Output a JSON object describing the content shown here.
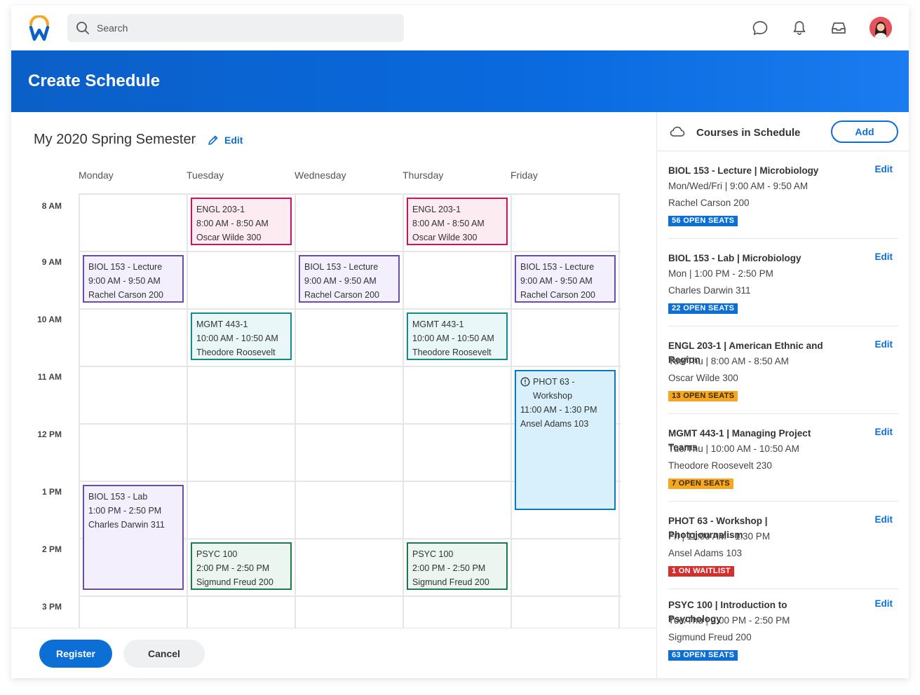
{
  "header": {
    "search_placeholder": "Search"
  },
  "banner": {
    "title": "Create Schedule"
  },
  "schedule": {
    "title": "My 2020 Spring Semester",
    "edit_label": "Edit",
    "days": [
      "Monday",
      "Tuesday",
      "Wednesday",
      "Thursday",
      "Friday"
    ],
    "times": [
      "8 AM",
      "9 AM",
      "10 AM",
      "11 AM",
      "12 PM",
      "1 PM",
      "2 PM",
      "3 PM"
    ],
    "events": {
      "engl_tue": [
        "ENGL 203-1",
        "8:00 AM - 8:50 AM",
        "Oscar Wilde 300"
      ],
      "engl_thu": [
        "ENGL 203-1",
        "8:00 AM - 8:50 AM",
        "Oscar Wilde 300"
      ],
      "biol_mon": [
        "BIOL 153 - Lecture",
        "9:00 AM - 9:50 AM",
        "Rachel Carson 200"
      ],
      "biol_wed": [
        "BIOL 153 - Lecture",
        "9:00 AM - 9:50 AM",
        "Rachel Carson 200"
      ],
      "biol_fri": [
        "BIOL 153 - Lecture",
        "9:00 AM - 9:50 AM",
        "Rachel Carson 200"
      ],
      "mgmt_tue": [
        "MGMT 443-1",
        "10:00 AM - 10:50 AM",
        "Theodore Roosevelt"
      ],
      "mgmt_thu": [
        "MGMT 443-1",
        "10:00 AM - 10:50 AM",
        "Theodore Roosevelt"
      ],
      "phot_fri": [
        "PHOT 63 -",
        "Workshop",
        "11:00 AM - 1:30 PM",
        "Ansel Adams 103"
      ],
      "lab_mon": [
        "BIOL 153 - Lab",
        "1:00 PM - 2:50 PM",
        "Charles Darwin 311"
      ],
      "psyc_tue": [
        "PSYC 100",
        "2:00 PM - 2:50 PM",
        "Sigmund Freud 200"
      ],
      "psyc_thu": [
        "PSYC 100",
        "2:00 PM - 2:50 PM",
        "Sigmund Freud 200"
      ]
    }
  },
  "footer": {
    "register_label": "Register",
    "cancel_label": "Cancel"
  },
  "panel": {
    "title": "Courses in Schedule",
    "add_label": "Add",
    "edit_label": "Edit",
    "courses": [
      {
        "name": "BIOL 153 - Lecture | Microbiology",
        "schedule": "Mon/Wed/Fri | 9:00 AM - 9:50 AM",
        "room": "Rachel Carson 200",
        "badge": "56 OPEN SEATS",
        "badge_color": "#0b6fd6"
      },
      {
        "name": "BIOL 153 - Lab | Microbiology",
        "schedule": "Mon | 1:00 PM - 2:50 PM",
        "room": "Charles Darwin 311",
        "badge": "22 OPEN SEATS",
        "badge_color": "#0b6fd6"
      },
      {
        "name": "ENGL 203-1 | American Ethnic and Region",
        "schedule": "Tue/Thu | 8:00 AM - 8:50 AM",
        "room": "Oscar Wilde 300",
        "badge": "13 OPEN SEATS",
        "badge_color": "#f5a623"
      },
      {
        "name": "MGMT 443-1 | Managing Project Teams",
        "schedule": "Tue/Thu | 10:00 AM - 10:50 AM",
        "room": "Theodore Roosevelt 230",
        "badge": "7 OPEN SEATS",
        "badge_color": "#f5a623"
      },
      {
        "name": "PHOT 63 - Workshop | Photojournalism",
        "schedule": "Fri | 11:00 AM - 1:30 PM",
        "room": "Ansel Adams 103",
        "badge": "1 ON WAITLIST",
        "badge_color": "#d32f2f"
      },
      {
        "name": "PSYC 100 | Introduction to Psychology",
        "schedule": "Tue/Thu | 2:00 PM - 2:50 PM",
        "room": "Sigmund Freud 200",
        "badge": "63 OPEN SEATS",
        "badge_color": "#0b6fd6"
      }
    ]
  },
  "icons": [
    "workday-logo-icon",
    "search-icon",
    "chat-icon",
    "bell-icon",
    "inbox-icon",
    "avatar",
    "pencil-icon",
    "cloud-icon",
    "alert-circle-icon"
  ],
  "colors": {
    "brand_blue": "#0b6fd6",
    "banner_blue": "#0a6adf",
    "engl": "#c2185b",
    "biol": "#6a4fa0",
    "mgmt": "#138a8a",
    "psyc": "#1e7a4a",
    "phot": "#0a7bb8"
  }
}
